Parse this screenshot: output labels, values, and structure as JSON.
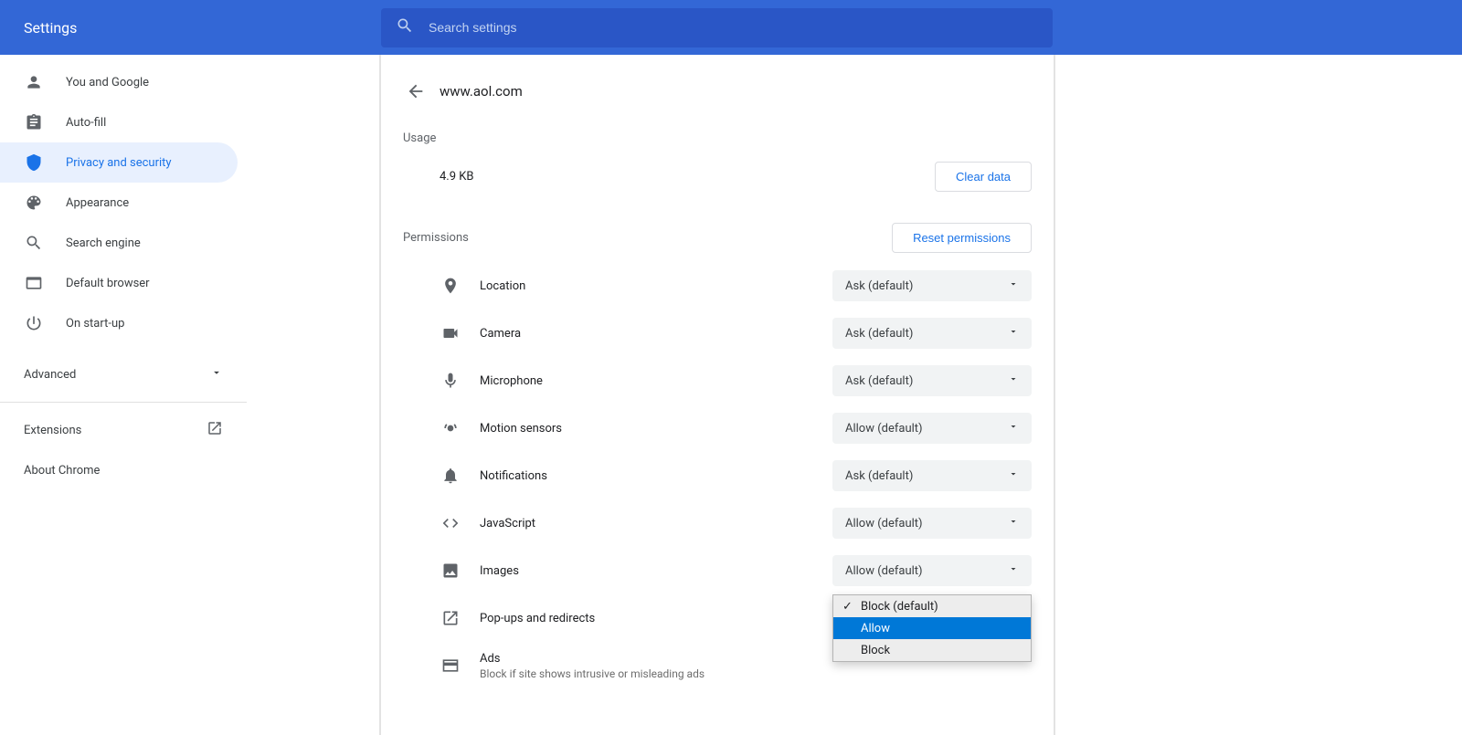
{
  "header": {
    "title": "Settings",
    "search_placeholder": "Search settings"
  },
  "sidebar": {
    "items": [
      {
        "label": "You and Google"
      },
      {
        "label": "Auto-fill"
      },
      {
        "label": "Privacy and security"
      },
      {
        "label": "Appearance"
      },
      {
        "label": "Search engine"
      },
      {
        "label": "Default browser"
      },
      {
        "label": "On start-up"
      }
    ],
    "advanced": "Advanced",
    "extensions": "Extensions",
    "about": "About Chrome"
  },
  "page": {
    "site": "www.aol.com",
    "usage_section": "Usage",
    "usage_size": "4.9 KB",
    "clear_data": "Clear data",
    "permissions_section": "Permissions",
    "reset_permissions": "Reset permissions",
    "permissions": [
      {
        "label": "Location",
        "value": "Ask (default)",
        "sub": ""
      },
      {
        "label": "Camera",
        "value": "Ask (default)",
        "sub": ""
      },
      {
        "label": "Microphone",
        "value": "Ask (default)",
        "sub": ""
      },
      {
        "label": "Motion sensors",
        "value": "Allow (default)",
        "sub": ""
      },
      {
        "label": "Notifications",
        "value": "Ask (default)",
        "sub": ""
      },
      {
        "label": "JavaScript",
        "value": "Allow (default)",
        "sub": ""
      },
      {
        "label": "Images",
        "value": "Allow (default)",
        "sub": ""
      },
      {
        "label": "Pop-ups and redirects",
        "value": "",
        "sub": ""
      },
      {
        "label": "Ads",
        "value": "",
        "sub": "Block if site shows intrusive or misleading ads"
      }
    ],
    "dropdown": {
      "opt0": "Block (default)",
      "opt1": "Allow",
      "opt2": "Block"
    }
  }
}
